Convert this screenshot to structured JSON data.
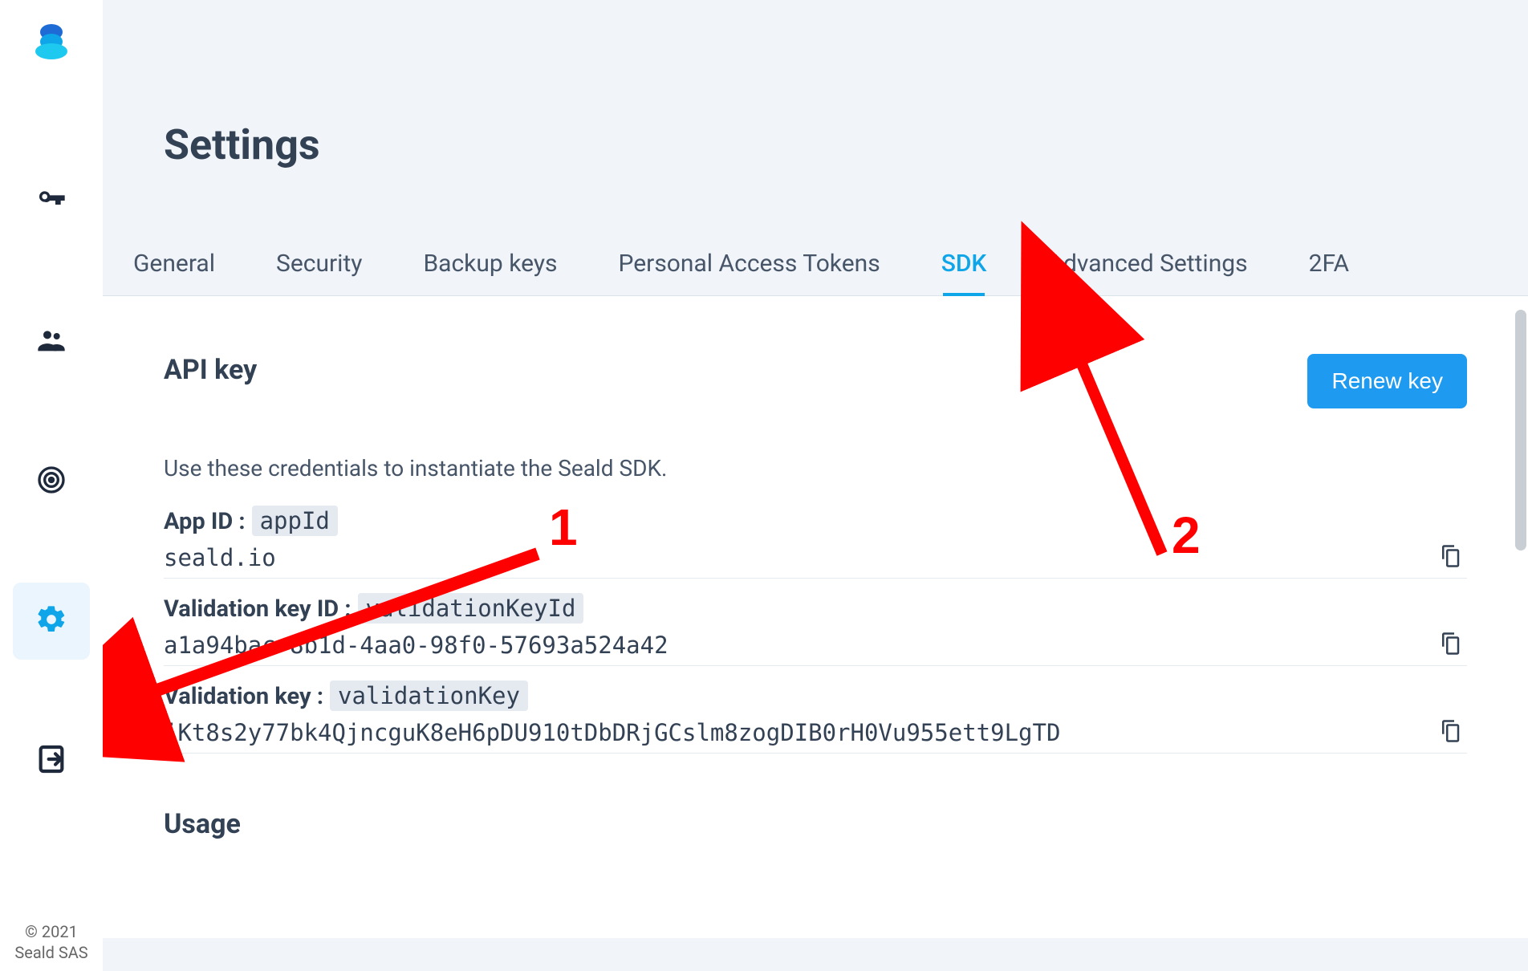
{
  "page": {
    "title": "Settings"
  },
  "sidebar": {
    "nav": [
      {
        "name": "sidebar-item-keys",
        "icon": "key-icon"
      },
      {
        "name": "sidebar-item-users",
        "icon": "people-icon"
      },
      {
        "name": "sidebar-item-target",
        "icon": "target-icon"
      },
      {
        "name": "sidebar-item-settings",
        "icon": "gear-icon",
        "active": true
      },
      {
        "name": "sidebar-item-logout",
        "icon": "logout-icon"
      }
    ],
    "footer_line1": "© 2021",
    "footer_line2": "Seald SAS"
  },
  "tabs": [
    {
      "label": "General"
    },
    {
      "label": "Security"
    },
    {
      "label": "Backup keys"
    },
    {
      "label": "Personal Access Tokens"
    },
    {
      "label": "SDK",
      "active": true
    },
    {
      "label": "Advanced Settings"
    },
    {
      "label": "2FA"
    }
  ],
  "apikey": {
    "section_title": "API key",
    "renew_button": "Renew key",
    "intro": "Use these credentials to instantiate the Seald SDK.",
    "items": [
      {
        "label": "App ID :",
        "code": "appId",
        "value": "seald.io"
      },
      {
        "label": "Validation key ID :",
        "code": "validationKeyId",
        "value": "a1a94bac-8b1d-4aa0-98f0-57693a524a42"
      },
      {
        "label": "Validation key :",
        "code": "validationKey",
        "value": "jKt8s2y77bk4QjncguK8eH6pDU910tDbDRjGCslm8zogDIB0rH0Vu955ett9LgTD"
      }
    ]
  },
  "usage": {
    "title": "Usage"
  },
  "annotations": {
    "num1": "1",
    "num2": "2"
  }
}
